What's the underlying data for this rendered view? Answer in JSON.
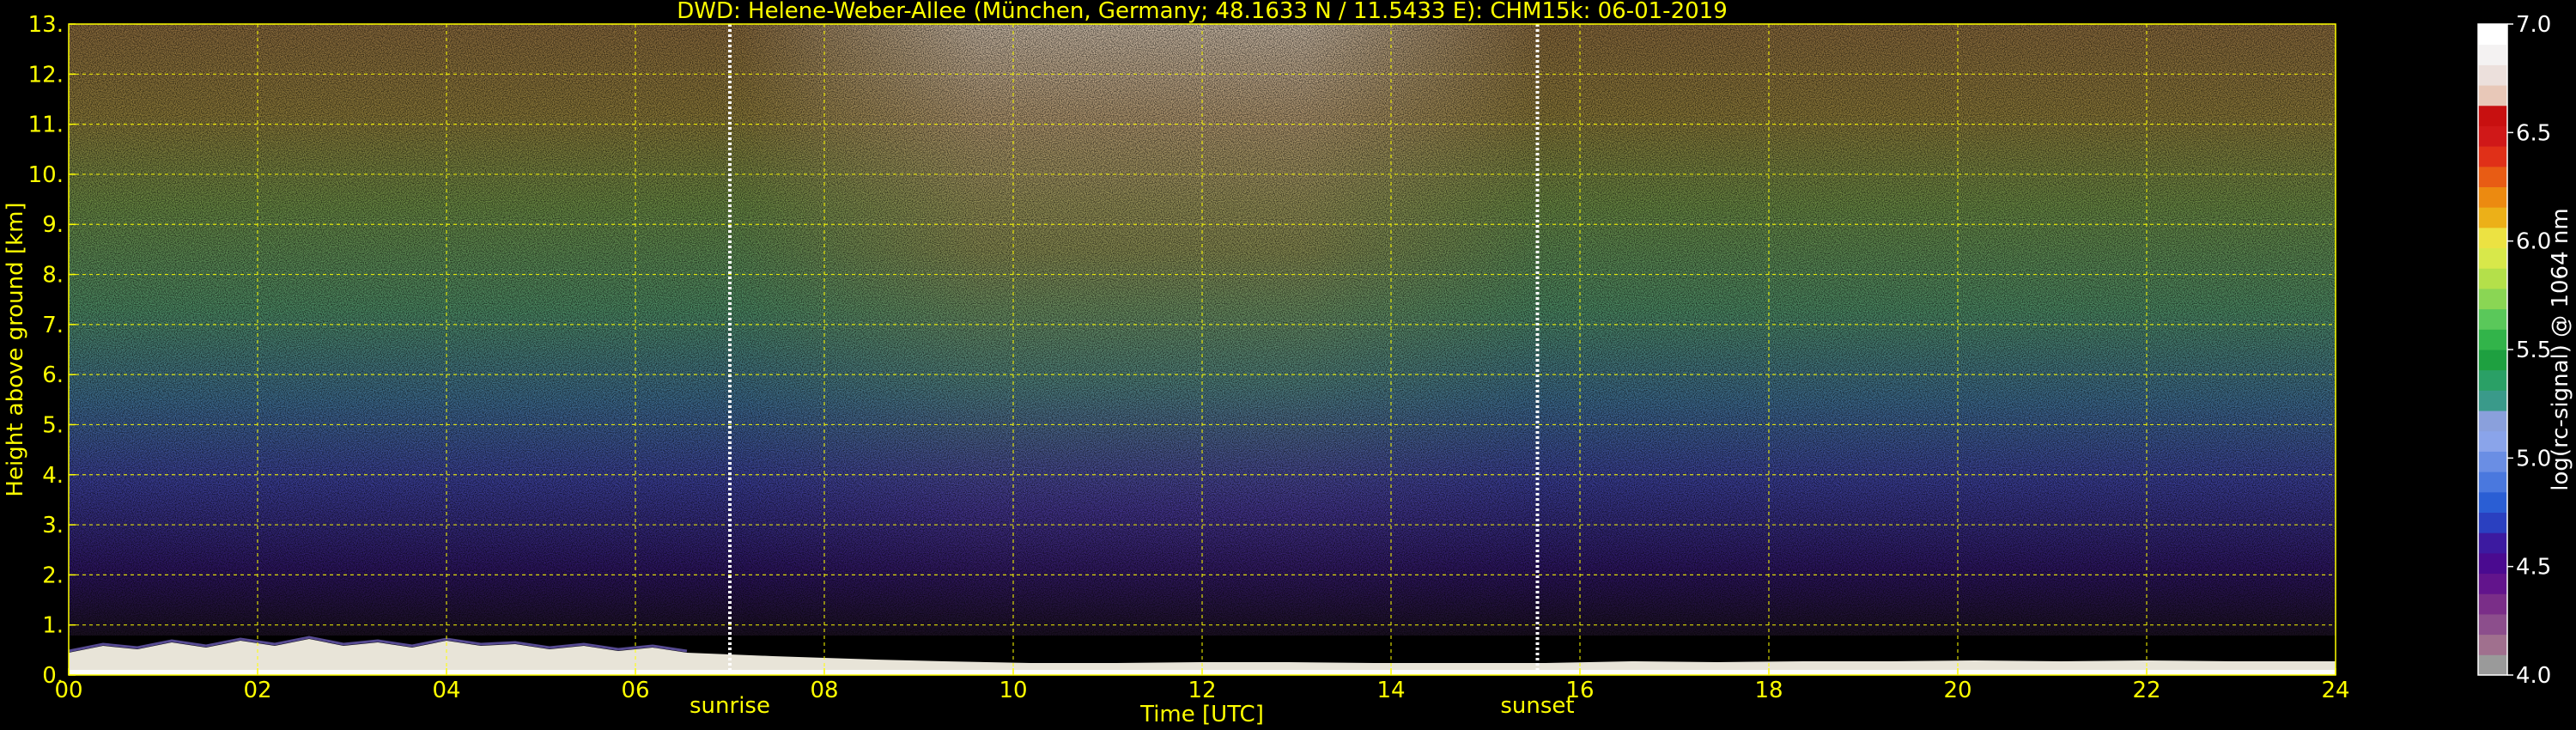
{
  "chart_data": {
    "type": "heatmap",
    "title": "DWD: Helene-Weber-Allee (München, Germany; 48.1633 N / 11.5433 E):    CHM15k: 06-01-2019",
    "xlabel": "Time [UTC]",
    "ylabel": "Height above ground [km]",
    "xlim": [
      0,
      24
    ],
    "ylim": [
      0,
      13
    ],
    "xticks": [
      "00",
      "02",
      "04",
      "06",
      "08",
      "10",
      "12",
      "14",
      "16",
      "18",
      "20",
      "22",
      "24"
    ],
    "yticks": [
      "0.",
      "1.",
      "2.",
      "3.",
      "4.",
      "5.",
      "6.",
      "7.",
      "8.",
      "9.",
      "10.",
      "11.",
      "12.",
      "13."
    ],
    "grid": true,
    "grid_color": "#ffff00",
    "annotations": [
      {
        "label": "sunrise",
        "x": 7.0
      },
      {
        "label": "sunset",
        "x": 15.55
      }
    ],
    "colorbar": {
      "label": "log(rc-signal) @ 1064 nm",
      "range": [
        4.0,
        7.0
      ],
      "ticks": [
        "4.0",
        "4.5",
        "5.0",
        "5.5",
        "6.0",
        "6.5",
        "7.0"
      ],
      "colors": [
        "#9a9a9a",
        "#a0708e",
        "#8c4e8c",
        "#7a2e88",
        "#62148c",
        "#4a0a90",
        "#3c1aa0",
        "#2a40c0",
        "#2a5ed4",
        "#4a78de",
        "#6a8ee4",
        "#8aa4ea",
        "#8aa0dc",
        "#3a9a8a",
        "#2aa066",
        "#1ea040",
        "#32b44a",
        "#5ac85a",
        "#8ad654",
        "#b4e04a",
        "#d8e84a",
        "#ece242",
        "#ecb018",
        "#ec8a10",
        "#e85c14",
        "#e03018",
        "#d01818",
        "#c81010",
        "#e8c8b8",
        "#ece0dc",
        "#f4f2f2",
        "#ffffff"
      ]
    }
  }
}
